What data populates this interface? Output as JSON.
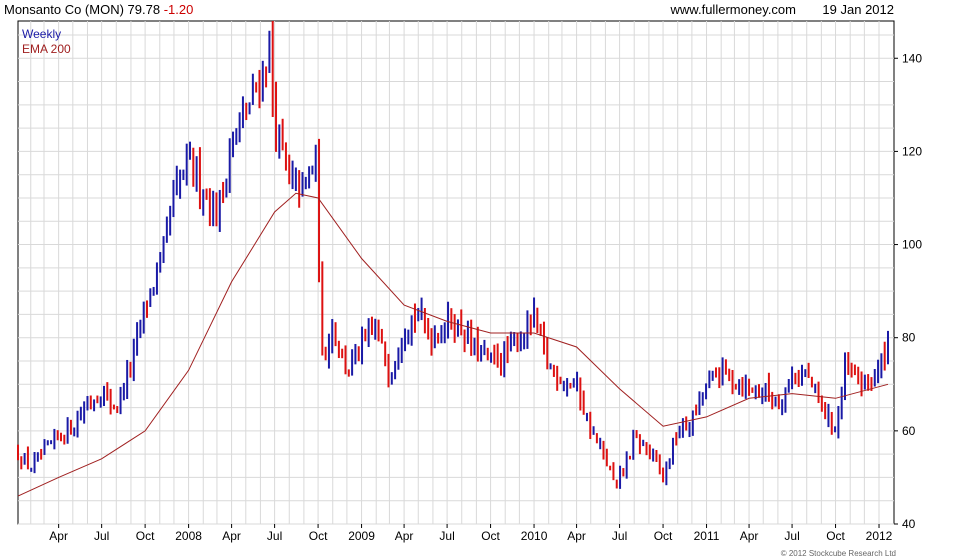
{
  "header": {
    "ticker_name": "Monsanto Co (MON)",
    "last_price": "79.78",
    "change": "-1.20",
    "site": "www.fullermoney.com",
    "date": "19 Jan 2012"
  },
  "legend": {
    "weekly": "Weekly",
    "ema": "EMA 200"
  },
  "copyright": "© 2012 Stockcube Research Ltd",
  "colors": {
    "up": "#1a1aa6",
    "down": "#dd1111",
    "ema": "#a02020",
    "grid": "#d9d9d9"
  },
  "chart_data": {
    "type": "candlestick",
    "frequency": "weekly",
    "x_range": [
      "2007-01-05",
      "2012-01-20"
    ],
    "ylim": [
      40,
      148
    ],
    "grid": true,
    "y_ticks": [
      40,
      60,
      80,
      100,
      120,
      140
    ],
    "x_ticks": [
      {
        "label": "Apr",
        "date": "2007-04-01"
      },
      {
        "label": "Jul",
        "date": "2007-07-01"
      },
      {
        "label": "Oct",
        "date": "2007-10-01"
      },
      {
        "label": "2008",
        "date": "2008-01-01"
      },
      {
        "label": "Apr",
        "date": "2008-04-01"
      },
      {
        "label": "Jul",
        "date": "2008-07-01"
      },
      {
        "label": "Oct",
        "date": "2008-10-01"
      },
      {
        "label": "2009",
        "date": "2009-01-01"
      },
      {
        "label": "Apr",
        "date": "2009-04-01"
      },
      {
        "label": "Jul",
        "date": "2009-07-01"
      },
      {
        "label": "Oct",
        "date": "2009-10-01"
      },
      {
        "label": "2010",
        "date": "2010-01-01"
      },
      {
        "label": "Apr",
        "date": "2010-04-01"
      },
      {
        "label": "Jul",
        "date": "2010-07-01"
      },
      {
        "label": "Oct",
        "date": "2010-10-01"
      },
      {
        "label": "2011",
        "date": "2011-01-01"
      },
      {
        "label": "Apr",
        "date": "2011-04-01"
      },
      {
        "label": "Jul",
        "date": "2011-07-01"
      },
      {
        "label": "Oct",
        "date": "2011-10-01"
      },
      {
        "label": "2012",
        "date": "2012-01-01"
      }
    ],
    "close_path": [
      [
        "2007-01-05",
        55
      ],
      [
        "2007-02-01",
        52
      ],
      [
        "2007-03-01",
        55
      ],
      [
        "2007-04-01",
        59
      ],
      [
        "2007-05-01",
        61
      ],
      [
        "2007-06-01",
        66
      ],
      [
        "2007-07-01",
        68
      ],
      [
        "2007-08-01",
        65
      ],
      [
        "2007-09-01",
        74
      ],
      [
        "2007-10-01",
        87
      ],
      [
        "2007-11-01",
        95
      ],
      [
        "2007-12-01",
        110
      ],
      [
        "2008-01-01",
        118
      ],
      [
        "2008-02-01",
        112
      ],
      [
        "2008-03-01",
        106
      ],
      [
        "2008-04-01",
        122
      ],
      [
        "2008-05-01",
        128
      ],
      [
        "2008-06-01",
        136
      ],
      [
        "2008-06-20",
        142
      ],
      [
        "2008-07-01",
        126
      ],
      [
        "2008-08-01",
        113
      ],
      [
        "2008-09-01",
        112
      ],
      [
        "2008-09-26",
        118
      ],
      [
        "2008-10-10",
        75
      ],
      [
        "2008-11-01",
        83
      ],
      [
        "2008-12-01",
        73
      ],
      [
        "2009-01-01",
        78
      ],
      [
        "2009-02-01",
        82
      ],
      [
        "2009-03-01",
        72
      ],
      [
        "2009-04-01",
        83
      ],
      [
        "2009-05-01",
        85
      ],
      [
        "2009-06-01",
        80
      ],
      [
        "2009-07-01",
        84
      ],
      [
        "2009-08-01",
        82
      ],
      [
        "2009-09-01",
        77
      ],
      [
        "2009-10-01",
        75
      ],
      [
        "2009-11-01",
        76
      ],
      [
        "2009-12-01",
        80
      ],
      [
        "2010-01-01",
        84
      ],
      [
        "2010-02-01",
        74
      ],
      [
        "2010-03-01",
        71
      ],
      [
        "2010-04-01",
        70
      ],
      [
        "2010-05-01",
        60
      ],
      [
        "2010-06-01",
        54
      ],
      [
        "2010-06-25",
        47
      ],
      [
        "2010-07-01",
        50
      ],
      [
        "2010-08-01",
        58
      ],
      [
        "2010-09-01",
        56
      ],
      [
        "2010-10-01",
        50
      ],
      [
        "2010-11-01",
        60
      ],
      [
        "2010-12-01",
        62
      ],
      [
        "2011-01-01",
        70
      ],
      [
        "2011-02-01",
        73
      ],
      [
        "2011-03-01",
        71
      ],
      [
        "2011-04-01",
        69
      ],
      [
        "2011-05-01",
        69
      ],
      [
        "2011-06-01",
        66
      ],
      [
        "2011-07-01",
        72
      ],
      [
        "2011-08-01",
        72
      ],
      [
        "2011-09-01",
        65
      ],
      [
        "2011-10-01",
        60
      ],
      [
        "2011-10-21",
        73
      ],
      [
        "2011-11-01",
        72
      ],
      [
        "2011-12-01",
        70
      ],
      [
        "2012-01-01",
        73
      ],
      [
        "2012-01-20",
        79.78
      ]
    ],
    "ema_200": [
      [
        "2007-01-05",
        46
      ],
      [
        "2007-04-01",
        50
      ],
      [
        "2007-07-01",
        54
      ],
      [
        "2007-10-01",
        60
      ],
      [
        "2008-01-01",
        73
      ],
      [
        "2008-04-01",
        92
      ],
      [
        "2008-07-01",
        107
      ],
      [
        "2008-08-15",
        111
      ],
      [
        "2008-10-01",
        110
      ],
      [
        "2009-01-01",
        97
      ],
      [
        "2009-04-01",
        87
      ],
      [
        "2009-07-01",
        83.5
      ],
      [
        "2009-10-01",
        81
      ],
      [
        "2010-01-01",
        81
      ],
      [
        "2010-04-01",
        78
      ],
      [
        "2010-07-01",
        69
      ],
      [
        "2010-10-01",
        61
      ],
      [
        "2011-01-01",
        63
      ],
      [
        "2011-04-01",
        67
      ],
      [
        "2011-07-01",
        68
      ],
      [
        "2011-10-01",
        67
      ],
      [
        "2012-01-20",
        70
      ]
    ]
  }
}
